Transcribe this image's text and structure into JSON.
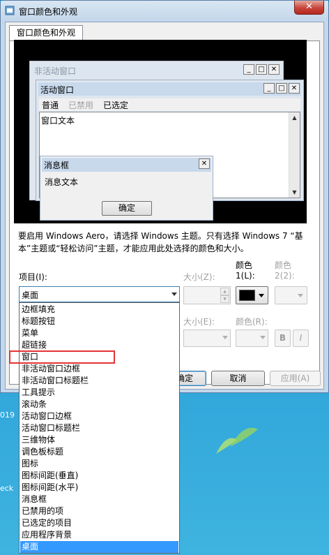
{
  "window": {
    "title": "窗口颜色和外观",
    "close_glyph": "✕"
  },
  "tab": {
    "label": "窗口颜色和外观"
  },
  "preview": {
    "inactive_title": "非活动窗口",
    "active_title": "活动窗口",
    "menu": [
      "普通",
      "已禁用",
      "已选定"
    ],
    "window_text": "窗口文本",
    "message_title": "消息框",
    "message_text": "消息文本",
    "ok_label": "确定",
    "caption_buttons": [
      "_",
      "□",
      "✕"
    ]
  },
  "info_text": "要启用 Windows Aero，请选择 Windows 主题。只有选择 Windows 7 “基本”主题或“轻松访问”主题，才能应用此处选择的颜色和大小。",
  "labels": {
    "item": "项目(I):",
    "size_z": "大小(Z):",
    "color1": "颜色\n1(L):",
    "color1_a": "颜色",
    "color1_b": "1(L):",
    "color2_a": "颜色",
    "color2_b": "2(2):",
    "size_e": "大小(E):",
    "color_r": "颜色(R):"
  },
  "item_combo": {
    "value": "桌面"
  },
  "format_buttons": {
    "bold": "B",
    "italic": "I"
  },
  "buttons": {
    "ok": "确定",
    "cancel": "取消",
    "apply": "应用(A)"
  },
  "dropdown_items": [
    "边框填充",
    "标题按钮",
    "菜单",
    "超链接",
    "窗口",
    "非活动窗口边框",
    "非活动窗口标题栏",
    "工具提示",
    "滚动条",
    "活动窗口边框",
    "活动窗口标题栏",
    "三维物体",
    "调色板标题",
    "图标",
    "图标间距(垂直)",
    "图标间距(水平)",
    "消息框",
    "已禁用的项",
    "已选定的项目",
    "应用程序背景",
    "桌面"
  ],
  "selected_item": "桌面",
  "highlighted_item": "窗口",
  "desktop_text": [
    "019",
    "eck"
  ],
  "colors": {
    "selection": "#3399ff",
    "highlight_box": "#e53333",
    "color1_swatch": "#000000"
  }
}
